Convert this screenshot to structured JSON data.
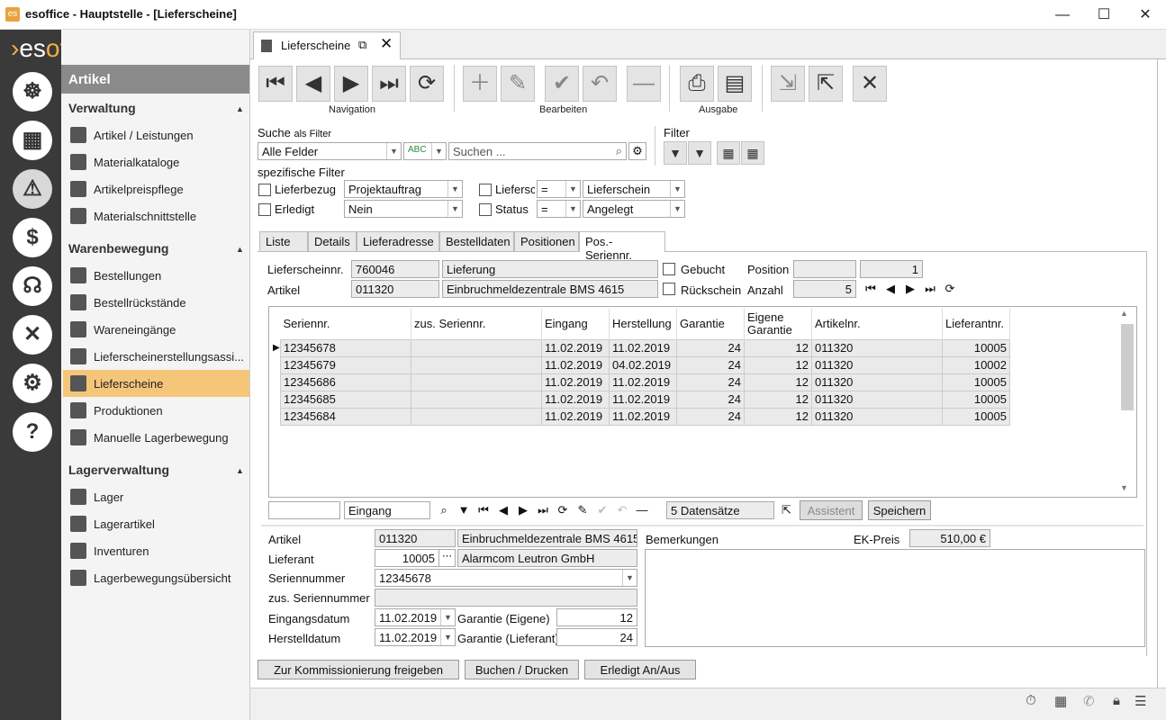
{
  "window": {
    "title": "esoffice - Hauptstelle - [Lieferscheine]",
    "app_icon": "app-logo-icon"
  },
  "brand": {
    "prefix": "es",
    "suffix": "office"
  },
  "rail": {
    "icons": [
      "helm-icon",
      "calendar-icon",
      "beacon-icon",
      "money-icon",
      "headset-icon",
      "tools-icon",
      "gears-icon",
      "help-icon"
    ]
  },
  "nav": {
    "header": "Artikel",
    "groups": [
      {
        "label": "Verwaltung",
        "items": [
          "Artikel / Leistungen",
          "Materialkataloge",
          "Artikelpreispflege",
          "Materialschnittstelle"
        ]
      },
      {
        "label": "Warenbewegung",
        "items": [
          "Bestellungen",
          "Bestellrückstände",
          "Wareneingänge",
          "Lieferscheinerstellungsassi...",
          "Lieferscheine",
          "Produktionen",
          "Manuelle Lagerbewegung"
        ]
      },
      {
        "label": "Lagerverwaltung",
        "items": [
          "Lager",
          "Lagerartikel",
          "Inventuren",
          "Lagerbewegungsübersicht"
        ]
      }
    ],
    "active": "Lieferscheine"
  },
  "doc_tab": {
    "label": "Lieferscheine"
  },
  "toolbar": {
    "groups": {
      "navigation": "Navigation",
      "edit": "Bearbeiten",
      "output": "Ausgabe"
    }
  },
  "search": {
    "label": "Suche",
    "as_filter": "als Filter",
    "field": "Alle Felder",
    "placeholder": "Suchen ...",
    "filter_label": "Filter",
    "specific": "spezifische Filter"
  },
  "filters": {
    "lieferbezug": {
      "label": "Lieferbezug",
      "value": "Projektauftrag"
    },
    "erledigt": {
      "label": "Erledigt",
      "value": "Nein"
    },
    "lieferschein_art": {
      "label": "Lieferschein",
      "op": "=",
      "value": "Lieferschein"
    },
    "status": {
      "label": "Status",
      "op": "=",
      "value": "Angelegt"
    }
  },
  "subtabs": [
    "Liste",
    "Details",
    "Lieferadresse",
    "Bestelldaten",
    "Positionen",
    "Pos.-Seriennr."
  ],
  "header_info": {
    "lieferscheinnr_label": "Lieferscheinnr.",
    "lieferscheinnr": "760046",
    "type": "Lieferung",
    "artikel_label": "Artikel",
    "artikel": "011320",
    "artikel_name": "Einbruchmeldezentrale BMS 4615",
    "gebucht_label": "Gebucht",
    "rueckschein_label": "Rückschein",
    "position_label": "Position",
    "position": "1",
    "anzahl_label": "Anzahl",
    "anzahl": "5"
  },
  "grid": {
    "columns": [
      "Seriennr.",
      "zus. Seriennr.",
      "Eingang",
      "Herstellung",
      "Garantie",
      "Eigene Garantie",
      "Artikelnr.",
      "Lieferantnr."
    ],
    "rows": [
      [
        "12345678",
        "",
        "11.02.2019",
        "11.02.2019",
        "24",
        "12",
        "011320",
        "10005"
      ],
      [
        "12345679",
        "",
        "11.02.2019",
        "04.02.2019",
        "24",
        "12",
        "011320",
        "10002"
      ],
      [
        "12345686",
        "",
        "11.02.2019",
        "11.02.2019",
        "24",
        "12",
        "011320",
        "10005"
      ],
      [
        "12345685",
        "",
        "11.02.2019",
        "11.02.2019",
        "24",
        "12",
        "011320",
        "10005"
      ],
      [
        "12345684",
        "",
        "11.02.2019",
        "11.02.2019",
        "24",
        "12",
        "011320",
        "10005"
      ]
    ]
  },
  "grid_nav": {
    "sort_field": "Eingang",
    "count": "5 Datensätze",
    "assistant": "Assistent",
    "save": "Speichern"
  },
  "detail": {
    "artikel_label": "Artikel",
    "artikel": "011320",
    "artikel_name": "Einbruchmeldezentrale BMS 4615",
    "lieferant_label": "Lieferant",
    "lieferant": "10005",
    "lieferant_name": "Alarmcom Leutron GmbH",
    "seriennr_label": "Seriennummer",
    "seriennr": "12345678",
    "zus_label": "zus. Seriennummer",
    "zus": "",
    "eingang_label": "Eingangsdatum",
    "eingang": "11.02.2019",
    "herstell_label": "Herstelldatum",
    "herstell": "11.02.2019",
    "garantie_eigene_label": "Garantie (Eigene)",
    "garantie_eigene": "12",
    "garantie_lief_label": "Garantie (Lieferant)",
    "garantie_lief": "24",
    "bemerkungen_label": "Bemerkungen",
    "ek_label": "EK-Preis",
    "ek": "510,00 €"
  },
  "actions": {
    "release": "Zur Kommissionierung freigeben",
    "book": "Buchen / Drucken",
    "done": "Erledigt An/Aus"
  }
}
